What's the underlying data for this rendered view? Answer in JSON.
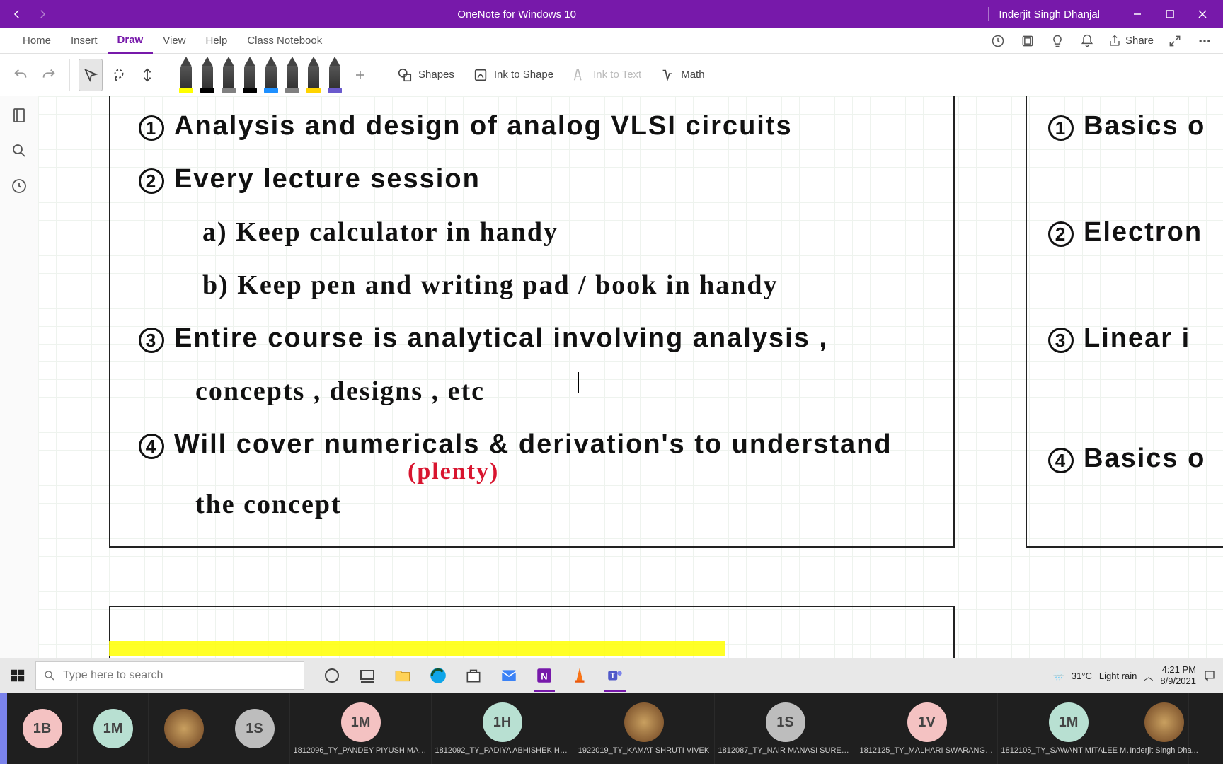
{
  "titlebar": {
    "app_title": "OneNote for Windows 10",
    "username": "Inderjit Singh Dhanjal"
  },
  "ribbon": {
    "tabs": [
      "Home",
      "Insert",
      "Draw",
      "View",
      "Help",
      "Class Notebook"
    ],
    "active_idx": 2,
    "share_label": "Share"
  },
  "draw_toolbar": {
    "shapes": "Shapes",
    "ink_to_shape": "Ink to Shape",
    "ink_to_text": "Ink to Text",
    "math": "Math",
    "pens": [
      {
        "cap": "#ffff00"
      },
      {
        "cap": "#000000"
      },
      {
        "cap": "#808080"
      },
      {
        "cap": "#000000"
      },
      {
        "cap": "#1e90ff"
      },
      {
        "cap": "#808080"
      },
      {
        "cap": "#ffd400"
      },
      {
        "cap": "#6a5acd"
      }
    ]
  },
  "notes": {
    "line1": "Analysis  and  design  of  analog  VLSI  circuits",
    "line2": "Every  lecture  session",
    "line2a": "a)  Keep  calculator  in  handy",
    "line2b": "b)  Keep  pen  and  writing  pad / book  in  handy",
    "line3": "Entire  course  is  analytical  involving  analysis ,",
    "line3b": "concepts ,  designs , etc",
    "line4": "Will  cover  numericals  &  derivation's  to  understand",
    "line4_red": "(plenty)",
    "line4b": "the  concept",
    "r1": "Basics  o",
    "r2": "Electron",
    "r3": "Linear  i",
    "r4": "Basics  o"
  },
  "taskbar": {
    "search_placeholder": "Type here to search",
    "weather_temp": "31°C",
    "weather_desc": "Light rain",
    "time": "4:21 PM",
    "date": "8/9/2021"
  },
  "participants": [
    {
      "initials": "1B",
      "color": "pink",
      "name": ""
    },
    {
      "initials": "1M",
      "color": "mint",
      "name": ""
    },
    {
      "initials": "",
      "color": "photo",
      "name": ""
    },
    {
      "initials": "1S",
      "color": "grey",
      "name": ""
    },
    {
      "initials": "1M",
      "color": "pink",
      "name": "1812096_TY_PANDEY PIYUSH MANOJ"
    },
    {
      "initials": "1H",
      "color": "mint",
      "name": "1812092_TY_PADIYA  ABHISHEK HAR..."
    },
    {
      "initials": "",
      "color": "photo",
      "name": "1922019_TY_KAMAT SHRUTI VIVEK"
    },
    {
      "initials": "1S",
      "color": "grey",
      "name": "1812087_TY_NAIR  MANASI SUREND..."
    },
    {
      "initials": "1V",
      "color": "pink",
      "name": "1812125_TY_MALHARI  SWARANGEE..."
    },
    {
      "initials": "1M",
      "color": "mint",
      "name": "1812105_TY_SAWANT  MITALEE MAH..."
    },
    {
      "initials": "",
      "color": "photo",
      "name": "Inderjit Singh Dha..."
    }
  ]
}
